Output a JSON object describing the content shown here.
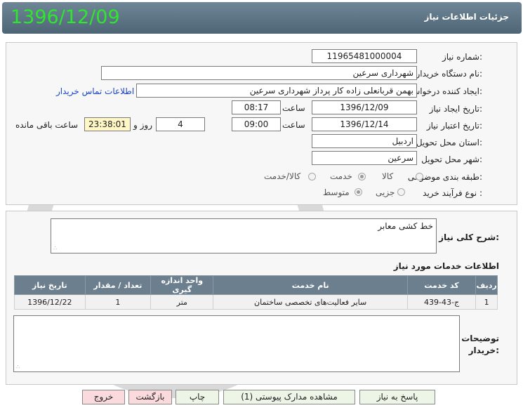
{
  "header": {
    "title": "جزئیات اطلاعات نیاز",
    "date": "1396/12/09"
  },
  "form": {
    "need_number_label": "شماره نیاز:",
    "need_number": "11965481000004",
    "buyer_label": "نام دستگاه خريدار:",
    "buyer": "شهرداری سرعین",
    "creator_label": "ایجاد کننده درخواست:",
    "creator": "بهمن قربانعلی زاده کار پرداز شهرداری سرعین",
    "contact_link": "اطلاعات تماس خريدار",
    "created_label": "تاریخ ایجاد نیاز:",
    "created_date": "1396/12/09",
    "time_label": "ساعت",
    "created_time": "08:17",
    "valid_label": "تاریخ اعتبار نیاز:",
    "valid_date": "1396/12/14",
    "valid_time": "09:00",
    "days": "4",
    "days_label": "روز و",
    "remaining": "23:38:01",
    "remaining_label": "ساعت باقی مانده",
    "province_label": "استان محل تحویل:",
    "province": "اردبیل",
    "city_label": "شهر محل تحویل:",
    "city": "سرعین",
    "category_label": "طبقه بندی موضوعی:",
    "category_options": [
      "کالا",
      "خدمت",
      "کالا/خدمت"
    ],
    "category_selected": "خدمت",
    "process_label": "نوع فرآیند خرید :",
    "process_options": [
      "جزیی",
      "متوسط"
    ],
    "process_selected": "متوسط"
  },
  "details": {
    "description_label": "شرح کلی نیاز:",
    "description": "خط کشی معابر",
    "services_title": "اطلاعات خدمات مورد نیاز",
    "columns": [
      "ردیف",
      "کد خدمت",
      "نام خدمت",
      "واحد اندازه گیری",
      "تعداد / مقدار",
      "تاریخ نیاز"
    ],
    "rows": [
      [
        "1",
        "ج-43-439",
        "سایر فعالیت‌های تخصصی ساختمان",
        "متر",
        "1",
        "1396/12/22"
      ]
    ],
    "buyer_notes_label_1": "توضیحات",
    "buyer_notes_label_2": "خریدار:",
    "buyer_notes": ""
  },
  "buttons": {
    "reply": "پاسخ به نیاز",
    "attachments": "مشاهده مدارک پیوستی (1)",
    "print": "چاپ",
    "back": "بازگشت",
    "exit": "خروج"
  }
}
